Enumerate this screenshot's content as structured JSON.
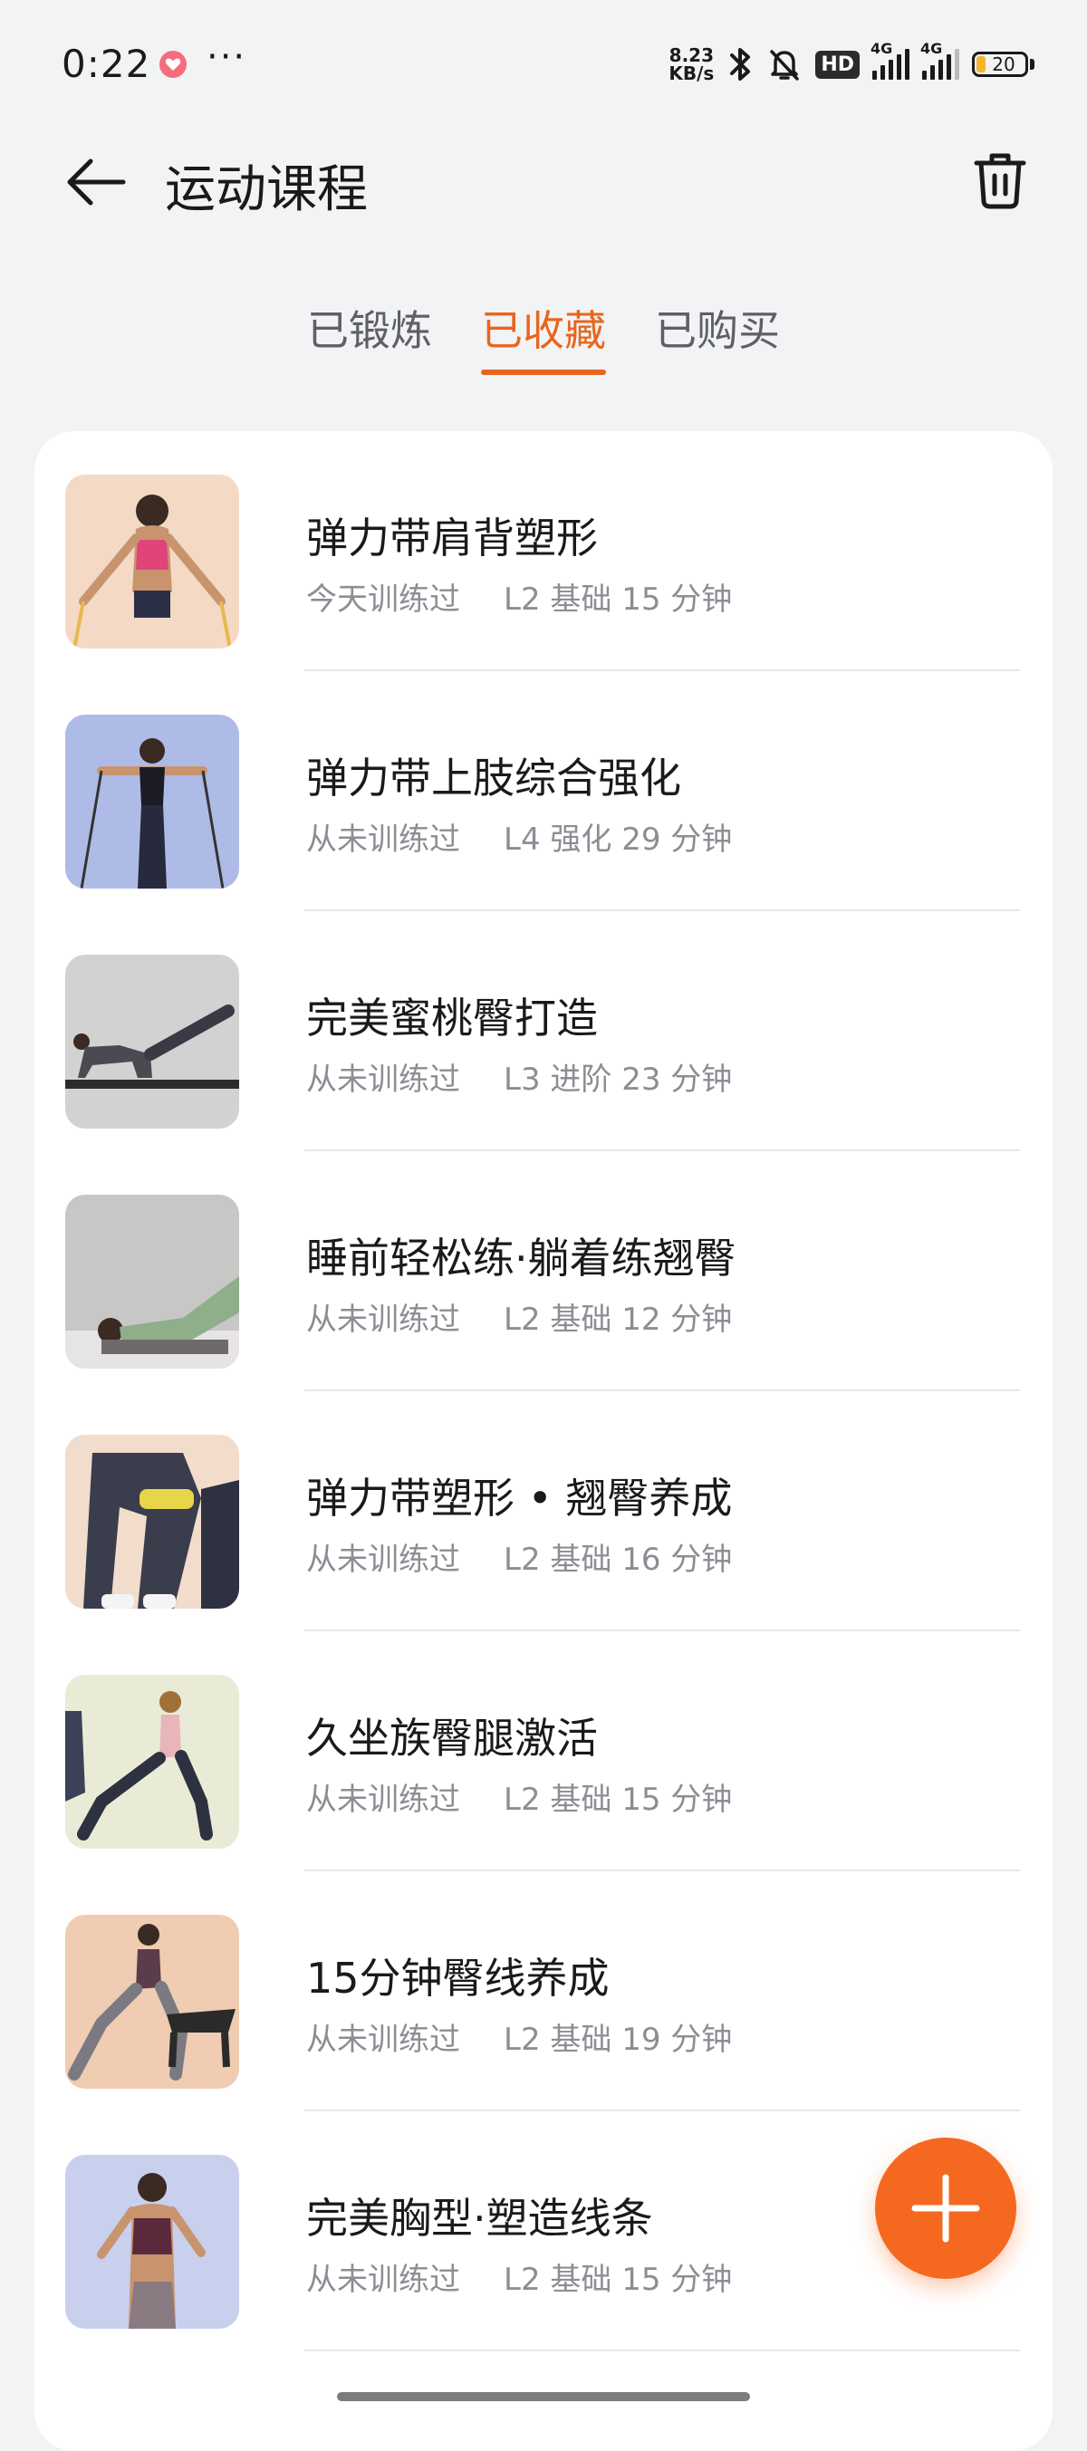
{
  "status_bar": {
    "time": "0:22",
    "more": "···",
    "speed_value": "8.23",
    "speed_unit": "KB/s",
    "hd": "HD",
    "network_1": "4G",
    "network_2": "4G",
    "battery": "20"
  },
  "header": {
    "title": "运动课程"
  },
  "tabs": [
    {
      "label": "已锻炼",
      "active": false
    },
    {
      "label": "已收藏",
      "active": true
    },
    {
      "label": "已购买",
      "active": false
    }
  ],
  "courses": [
    {
      "title": "弹力带肩背塑形",
      "trained": "今天训练过",
      "level": "L2 基础 15 分钟"
    },
    {
      "title": "弹力带上肢综合强化",
      "trained": "从未训练过",
      "level": "L4 强化 29 分钟"
    },
    {
      "title": "完美蜜桃臀打造",
      "trained": "从未训练过",
      "level": "L3 进阶 23 分钟"
    },
    {
      "title": "睡前轻松练·躺着练翘臀",
      "trained": "从未训练过",
      "level": "L2 基础 12 分钟"
    },
    {
      "title": "弹力带塑形 • 翘臀养成",
      "trained": "从未训练过",
      "level": "L2 基础 16 分钟"
    },
    {
      "title": "久坐族臀腿激活",
      "trained": "从未训练过",
      "level": "L2 基础 15 分钟"
    },
    {
      "title": "15分钟臀线养成",
      "trained": "从未训练过",
      "level": "L2 基础 19 分钟"
    },
    {
      "title": "完美胸型·塑造线条",
      "trained": "从未训练过",
      "level": "L2 基础 15 分钟"
    }
  ],
  "colors": {
    "accent": "#e8651e",
    "fab": "#f4691f",
    "background": "#f1f3f5",
    "secondary_text": "#8b8e94"
  },
  "icons": {
    "back": "arrow-left-icon",
    "delete": "trash-icon",
    "add": "plus-icon"
  }
}
